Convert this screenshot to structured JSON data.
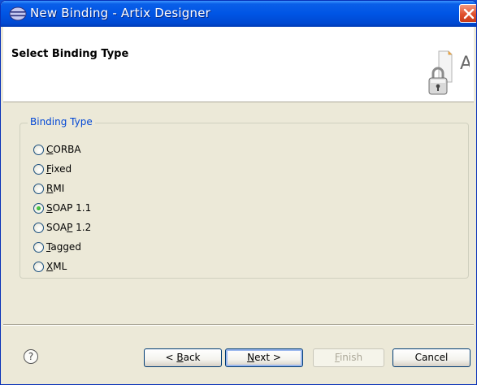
{
  "window": {
    "title": "New Binding - Artix Designer"
  },
  "banner": {
    "title": "Select Binding Type"
  },
  "binding_group": {
    "legend": "Binding Type",
    "options": [
      {
        "label": "CORBA",
        "mnemonic_index": 0,
        "checked": false
      },
      {
        "label": "Fixed",
        "mnemonic_index": 0,
        "checked": false
      },
      {
        "label": "RMI",
        "mnemonic_index": 0,
        "checked": false
      },
      {
        "label": "SOAP 1.1",
        "mnemonic_index": 0,
        "checked": true
      },
      {
        "label": "SOAP 1.2",
        "mnemonic_index": 3,
        "checked": false
      },
      {
        "label": "Tagged",
        "mnemonic_index": 0,
        "checked": false
      },
      {
        "label": "XML",
        "mnemonic_index": 0,
        "checked": false
      }
    ]
  },
  "buttons": {
    "help": "?",
    "back": "< Back",
    "next": "Next >",
    "finish": "Finish",
    "cancel": "Cancel"
  },
  "colors": {
    "titlebar": "#0055e5",
    "legend": "#0046d5",
    "radio_checked": "#21a11d"
  }
}
